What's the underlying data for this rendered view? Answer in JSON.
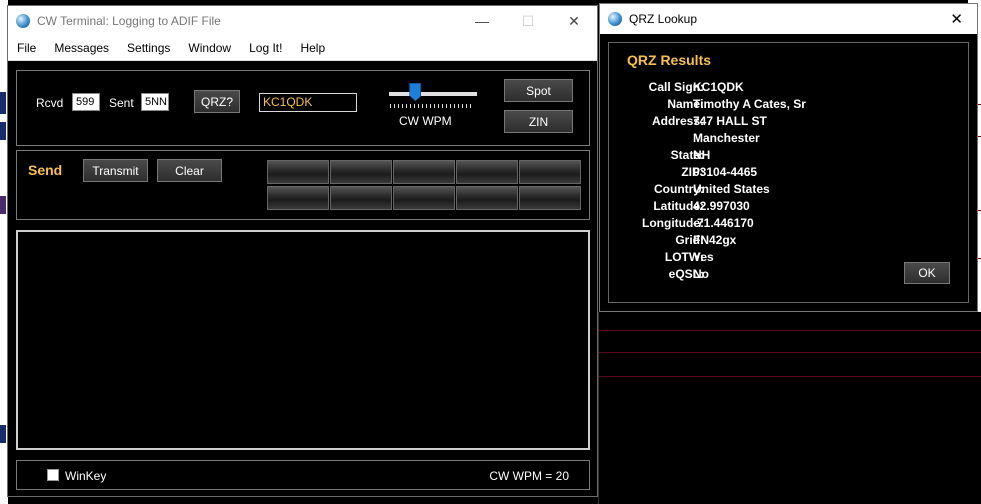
{
  "terminal": {
    "title": "CW Terminal: Logging to ADIF File",
    "menu": [
      "File",
      "Messages",
      "Settings",
      "Window",
      "Log It!",
      "Help"
    ],
    "rcvd_label": "Rcvd",
    "rcvd_value": "599",
    "sent_label": "Sent",
    "sent_value": "5NN",
    "qrz_button": "QRZ?",
    "callsign_value": "KC1QDK",
    "wpm_slider_label": "CW WPM",
    "wpm_slider_fraction": 0.3,
    "spot_button": "Spot",
    "zin_button": "ZIN",
    "send_label": "Send",
    "transmit_button": "Transmit",
    "clear_button": "Clear",
    "winkey_label": "WinKey",
    "winkey_checked": false,
    "status_wpm": "CW WPM = 20"
  },
  "qrz": {
    "title": "QRZ Lookup",
    "heading": "QRZ Results",
    "fields": [
      {
        "label": "Call Sign:",
        "value": "KC1QDK"
      },
      {
        "label": "Name:",
        "value": "Timothy A Cates, Sr"
      },
      {
        "label": "Address:",
        "value": "747 HALL ST"
      },
      {
        "label": "",
        "value": "Manchester"
      },
      {
        "label": "State:",
        "value": "NH"
      },
      {
        "label": "ZIP:",
        "value": "03104-4465"
      },
      {
        "label": "Country:",
        "value": "United States"
      },
      {
        "label": "Latitude:",
        "value": "42.997030"
      },
      {
        "label": "Longitude:",
        "value": "-71.446170"
      },
      {
        "label": "Grid:",
        "value": "FN42gx"
      },
      {
        "label": "LOTW:",
        "value": "Yes"
      },
      {
        "label": "eQSL:",
        "value": "No"
      }
    ],
    "ok_button": "OK"
  },
  "colors": {
    "accent": "#f6c04a",
    "background": "#000000"
  }
}
